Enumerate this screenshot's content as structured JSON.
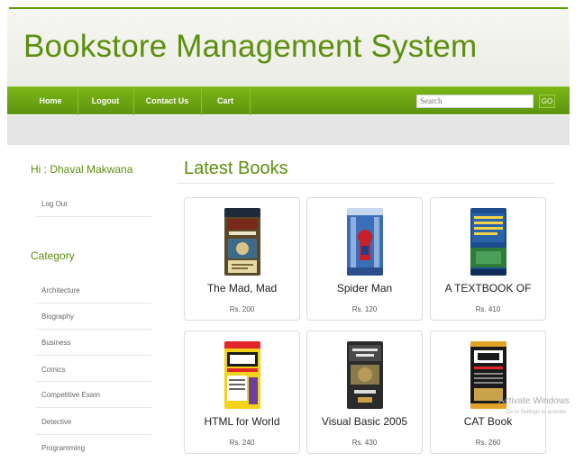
{
  "app": {
    "title": "Bookstore Management System"
  },
  "nav": {
    "items": [
      "Home",
      "Logout",
      "Contact Us",
      "Cart"
    ],
    "search_placeholder": "Search",
    "search_button": "GO"
  },
  "sidebar": {
    "greeting": "Hi : Dhaval Makwana",
    "logout_link": "Log Out",
    "category_title": "Category",
    "categories": [
      "Architecture",
      "Biography",
      "Business",
      "Comics",
      "Competitive Exam",
      "Detective",
      "Programming"
    ]
  },
  "main": {
    "section_title": "Latest Books",
    "books": [
      {
        "title": "The Mad, Mad",
        "price": "Rs. 200",
        "cover_icon": "cricket-book-cover"
      },
      {
        "title": "Spider Man",
        "price": "Rs. 120",
        "cover_icon": "spiderman-comic-cover"
      },
      {
        "title": "A TEXTBOOK OF",
        "price": "Rs. 410",
        "cover_icon": "cost-accounting-book-cover"
      },
      {
        "title": "HTML for World",
        "price": "Rs. 240",
        "cover_icon": "html-book-cover"
      },
      {
        "title": "Visual Basic 2005",
        "price": "Rs. 430",
        "cover_icon": "visual-basic-book-cover"
      },
      {
        "title": "CAT Book",
        "price": "Rs. 260",
        "cover_icon": "cat-book-cover"
      }
    ]
  },
  "overlay": {
    "watermark_line1": "Activate Windows",
    "watermark_line2": "Go to Settings to activate"
  },
  "colors": {
    "brand_green": "#5b8f0c",
    "nav_green": "#6ea814",
    "subbar_gray": "#e4e4e4"
  }
}
